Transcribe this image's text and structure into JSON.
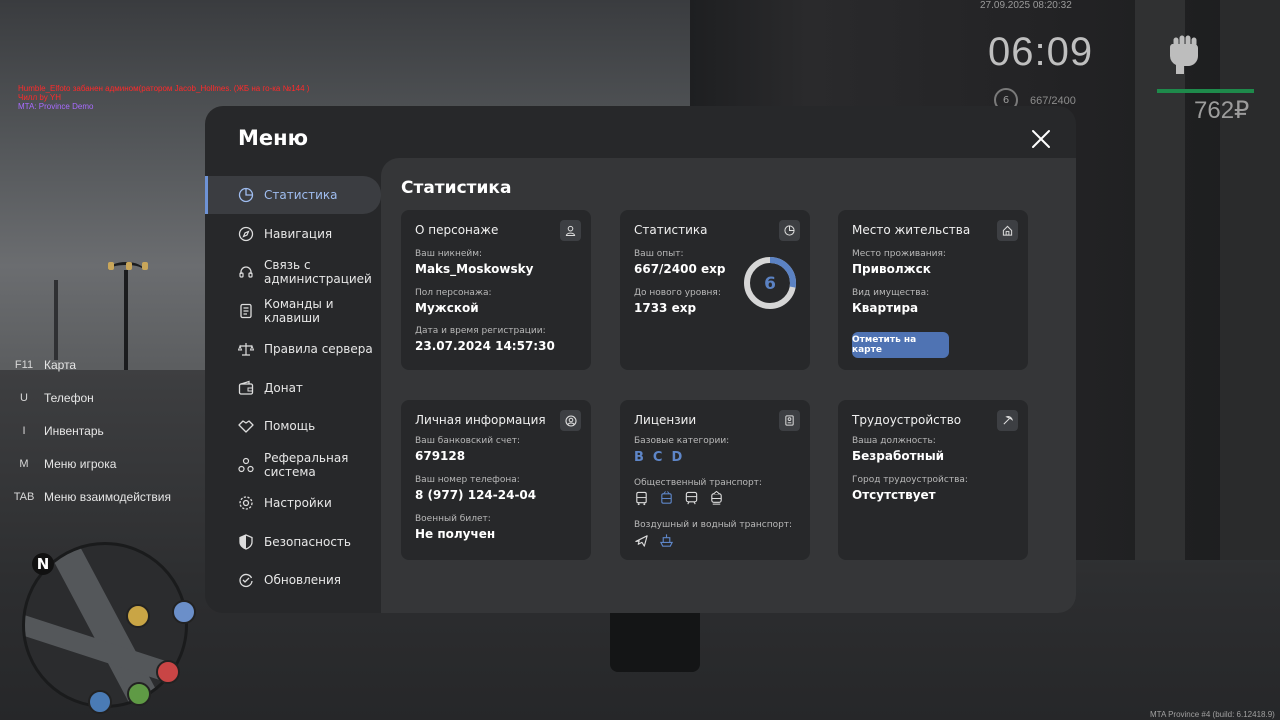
{
  "debug": {
    "line1": "Humble_Elfoto забанен админом(ратором Jacob_Hollmes. (ЖБ на го-ка №144 )",
    "line2": "Чилл by YH",
    "line3": "MTA: Province Demo"
  },
  "hud": {
    "datetime": "27.09.2025 08:20:32",
    "time": "06:09",
    "level": "6",
    "exp": "667/2400",
    "money": "762₽",
    "health_color": "#1e8a4b"
  },
  "keybinds": [
    {
      "key": "F11",
      "label": "Карта"
    },
    {
      "key": "U",
      "label": "Телефон"
    },
    {
      "key": "I",
      "label": "Инвентарь"
    },
    {
      "key": "M",
      "label": "Меню игрока"
    },
    {
      "key": "TAB",
      "label": "Меню взаимодействия"
    }
  ],
  "minimap": {
    "north": "N"
  },
  "build": "MTA Province #4 (build: 6.12418.9)",
  "menu": {
    "title": "Меню",
    "accent": "#6e93d6",
    "sidebar": [
      {
        "label": "Статистика",
        "icon": "stats-icon",
        "active": true
      },
      {
        "label": "Навигация",
        "icon": "compass-icon"
      },
      {
        "label": "Связь с администрацией",
        "icon": "headset-icon"
      },
      {
        "label": "Команды и клавиши",
        "icon": "document-icon"
      },
      {
        "label": "Правила сервера",
        "icon": "scales-icon"
      },
      {
        "label": "Донат",
        "icon": "wallet-icon"
      },
      {
        "label": "Помощь",
        "icon": "handshake-icon"
      },
      {
        "label": "Реферальная система",
        "icon": "referral-icon"
      },
      {
        "label": "Настройки",
        "icon": "gear-icon"
      },
      {
        "label": "Безопасность",
        "icon": "shield-icon"
      },
      {
        "label": "Обновления",
        "icon": "refresh-icon"
      }
    ],
    "content_title": "Статистика",
    "cards": {
      "character": {
        "title": "О персонаже",
        "nickname_label": "Ваш никнейм:",
        "nickname": "Maks_Moskowsky",
        "gender_label": "Пол персонажа:",
        "gender": "Мужской",
        "reg_label": "Дата и время регистрации:",
        "reg": "23.07.2024 14:57:30"
      },
      "stats": {
        "title": "Статистика",
        "exp_label": "Ваш опыт:",
        "exp": "667/2400 exp",
        "next_label": "До нового уровня:",
        "next": "1733 exp",
        "level": "6",
        "progress": 0.278
      },
      "residence": {
        "title": "Место жительства",
        "place_label": "Место проживания:",
        "place": "Приволжск",
        "property_label": "Вид имущества:",
        "property": "Квартира",
        "button": "Отметить на карте"
      },
      "personal": {
        "title": "Личная информация",
        "bank_label": "Ваш банковский счет:",
        "bank": "679128",
        "phone_label": "Ваш номер телефона:",
        "phone": "8 (977) 124-24-04",
        "military_label": "Военный билет:",
        "military": "Не получен"
      },
      "licenses": {
        "title": "Лицензии",
        "base_label": "Базовые категории:",
        "base": [
          "B",
          "C",
          "D"
        ],
        "public_label": "Общественный транспорт:",
        "air_label": "Воздушный и водный транспорт:"
      },
      "job": {
        "title": "Трудоустройство",
        "position_label": "Ваша должность:",
        "position": "Безработный",
        "city_label": "Город трудоустройства:",
        "city": "Отсутствует"
      }
    }
  }
}
